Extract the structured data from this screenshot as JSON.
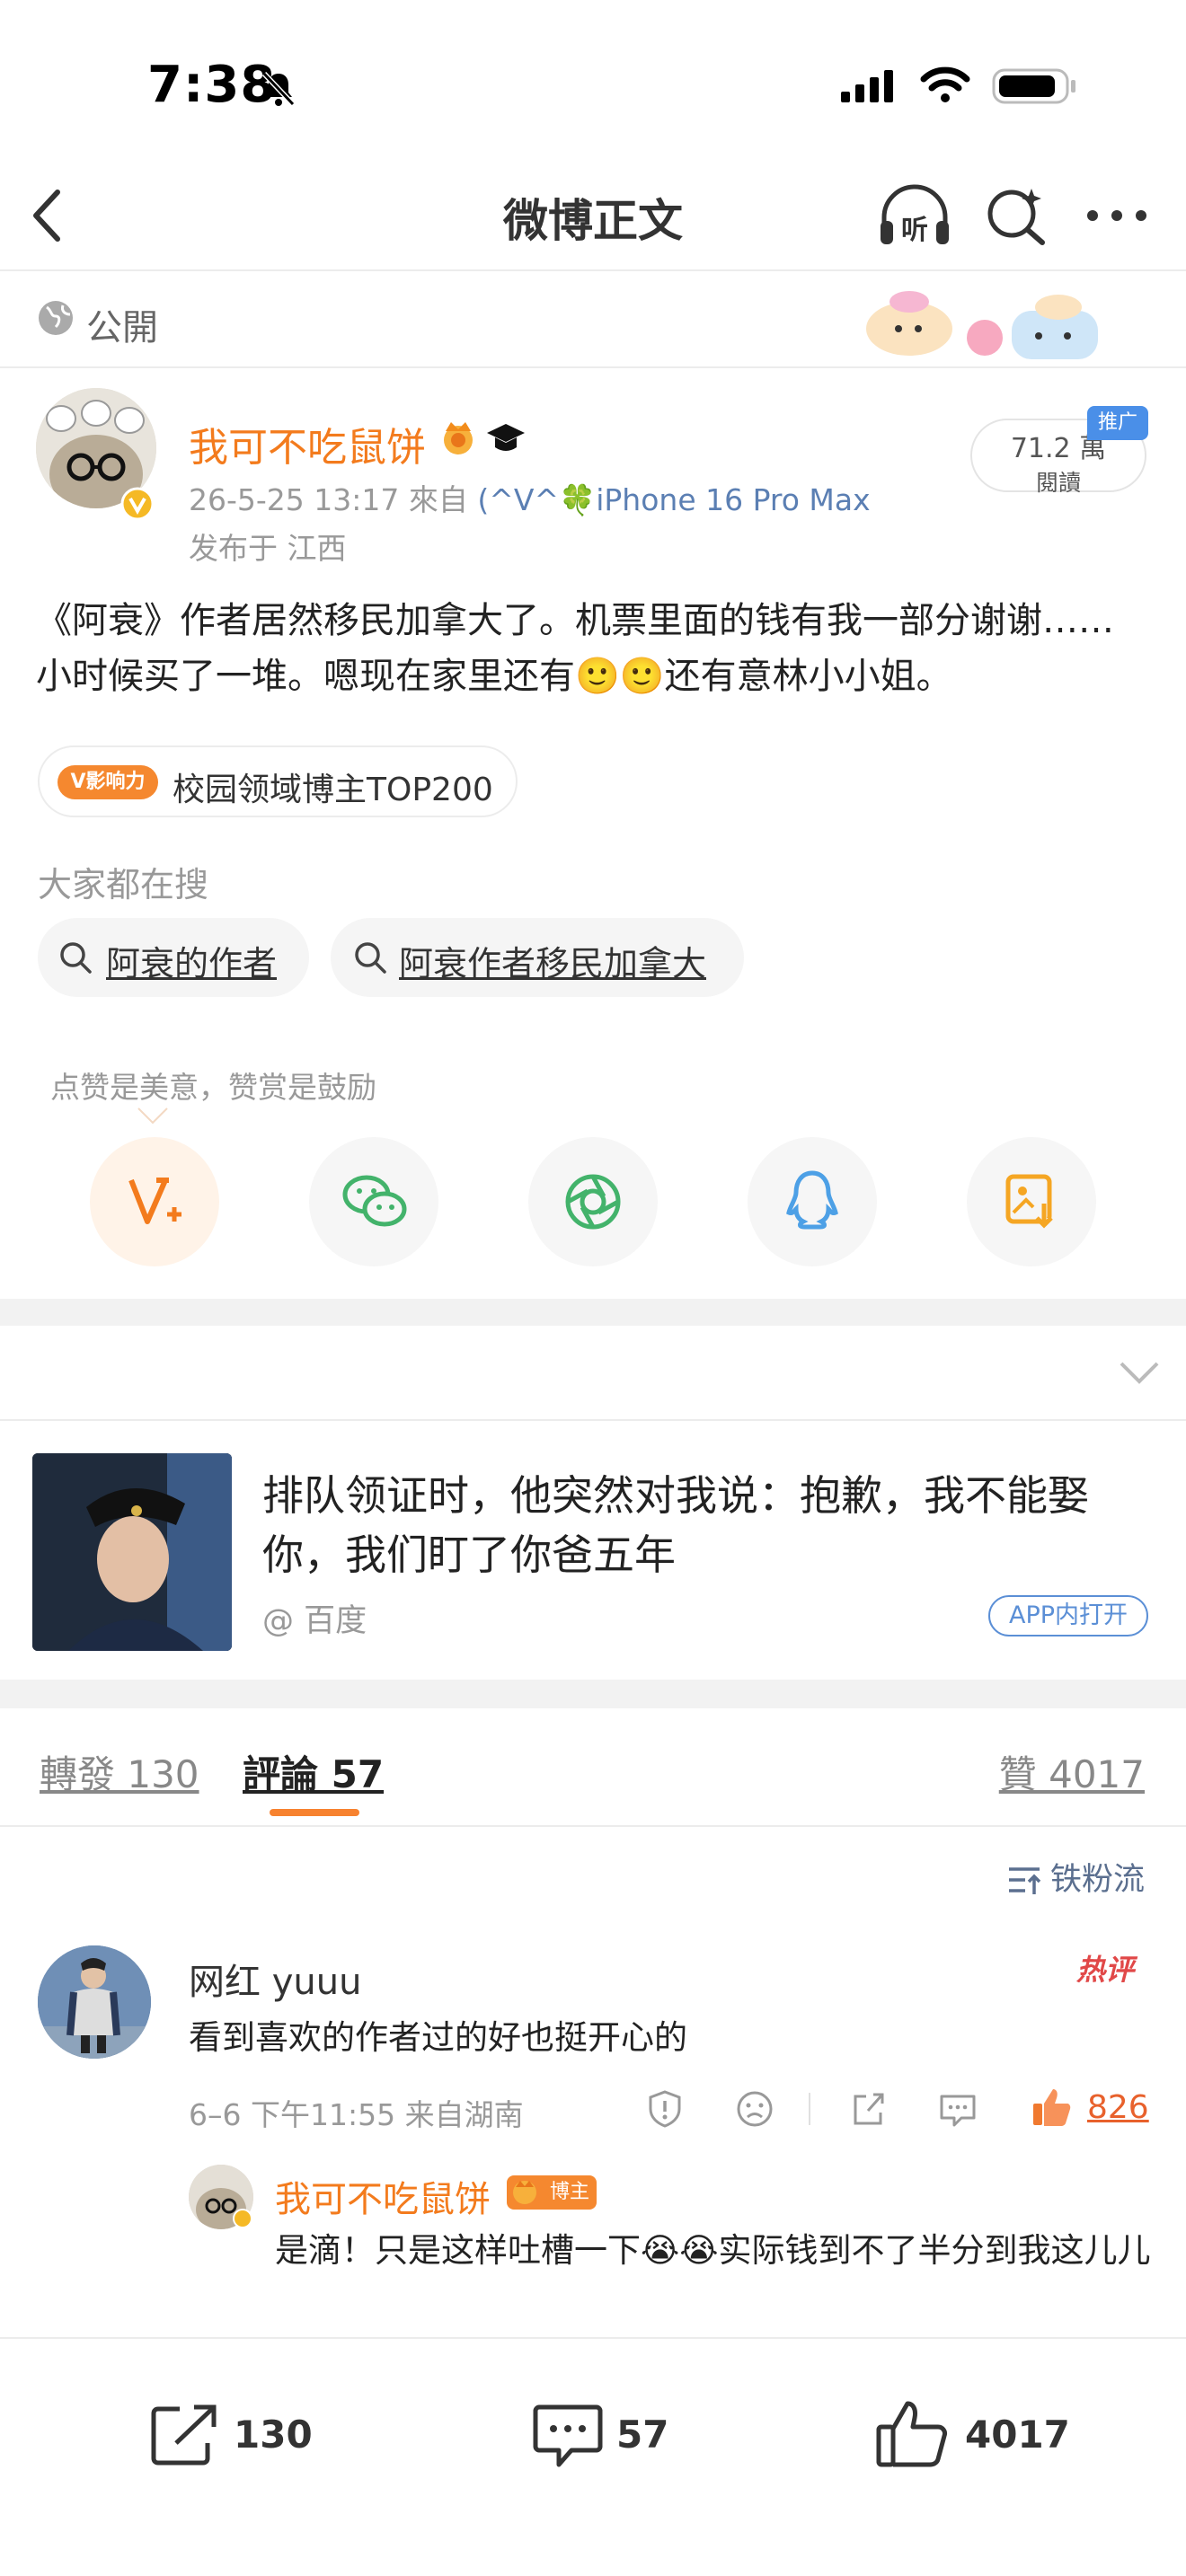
{
  "status": {
    "time": "7:38"
  },
  "nav": {
    "title": "微博正文"
  },
  "visibility": {
    "label": "公開"
  },
  "author": {
    "name": "我可不吃鼠饼",
    "date": "26-5-25 13:17",
    "source_prefix": "來自",
    "device": "(^V^🍀iPhone 16 Pro Max",
    "location": "发布于 江西",
    "reads_value": "71.2 萬",
    "reads_label": "閱讀",
    "promo": "推广"
  },
  "post": {
    "line1": "《阿衰》作者居然移民加拿大了。机票里面的钱有我一部分谢谢……",
    "line2": "小时候买了一堆。嗯现在家里还有🙂🙂还有意林小小姐。"
  },
  "influence": {
    "badge": "V影响力",
    "text": "校园领域博主TOP200"
  },
  "search": {
    "heading": "大家都在搜",
    "chips": [
      "阿衰的作者",
      "阿衰作者移民加拿大"
    ]
  },
  "share": {
    "tip": "点赞是美意，赞赏是鼓励"
  },
  "ad": {
    "title": "排队领证时，他突然对我说：抱歉，我不能娶你，我们盯了你爸五年",
    "source": "@ 百度",
    "open_label": "APP内打开"
  },
  "tabs": {
    "repost": "轉發 130",
    "comments": "評論 57",
    "likes": "贊 4017"
  },
  "sort": {
    "label": "铁粉流"
  },
  "comment": {
    "user": "网红 yuuu",
    "text": "看到喜欢的作者过的好也挺开心的",
    "meta": "6–6 下午11:55  来自湖南",
    "hot": "热评",
    "likes": "826"
  },
  "reply": {
    "user": "我可不吃鼠饼",
    "badge": "博主",
    "text": "是滴！只是这样吐槽一下😭😭实际钱到不了半分到我这儿儿"
  },
  "bottom": {
    "reposts": "130",
    "comments": "57",
    "likes": "4017"
  },
  "colors": {
    "accent": "#f37b1d",
    "link": "#5b7fb3",
    "hot": "#e14848"
  }
}
